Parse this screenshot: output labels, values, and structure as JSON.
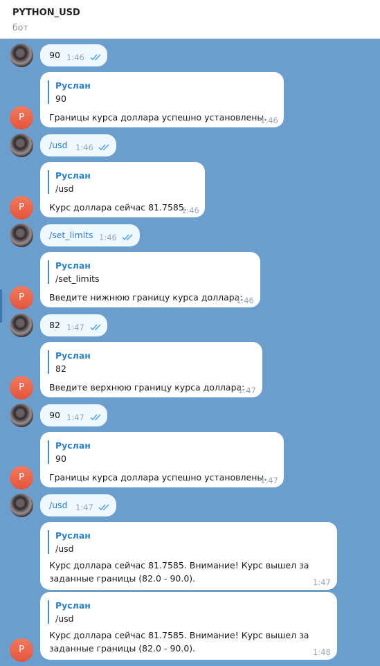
{
  "header": {
    "title": "PYTHON_USD",
    "subtitle": "бот"
  },
  "bot_avatar_letter": "Р",
  "messages": [
    {
      "kind": "out",
      "text": "90",
      "time": "1:46"
    },
    {
      "kind": "in",
      "reply_name": "Руслан",
      "reply_text": "90",
      "body": "Границы курса доллара успешно установлены.",
      "time": "1:46"
    },
    {
      "kind": "out",
      "text": "/usd",
      "time": "1:46"
    },
    {
      "kind": "in",
      "reply_name": "Руслан",
      "reply_text": "/usd",
      "body": "Курс доллара сейчас 81.7585.",
      "time": "1:46"
    },
    {
      "kind": "out",
      "text": "/set_limits",
      "time": "1:46"
    },
    {
      "kind": "in",
      "reply_name": "Руслан",
      "reply_text": "/set_limits",
      "body": "Введите нижнюю границу курса доллара:",
      "time": "1:46"
    },
    {
      "kind": "out",
      "text": "82",
      "time": "1:47"
    },
    {
      "kind": "in",
      "reply_name": "Руслан",
      "reply_text": "82",
      "body": "Введите верхнюю границу курса доллара:",
      "time": "1:47"
    },
    {
      "kind": "out",
      "text": "90",
      "time": "1:47"
    },
    {
      "kind": "in",
      "reply_name": "Руслан",
      "reply_text": "90",
      "body": "Границы курса доллара успешно установлены.",
      "time": "1:47"
    },
    {
      "kind": "out",
      "text": "/usd",
      "time": "1:47"
    },
    {
      "kind": "in",
      "reply_name": "Руслан",
      "reply_text": "/usd",
      "body_line1": "Курс доллара сейчас 81.7585. Внимание! Курс вышел за",
      "body_line2": "заданные границы (82.0 - 90.0).",
      "time": "1:47"
    },
    {
      "kind": "in",
      "reply_name": "Руслан",
      "reply_text": "/usd",
      "body_line1": "Курс доллара сейчас 81.7585. Внимание! Курс вышел за",
      "body_line2": "заданные границы (82.0 - 90.0).",
      "time": "1:48"
    }
  ]
}
